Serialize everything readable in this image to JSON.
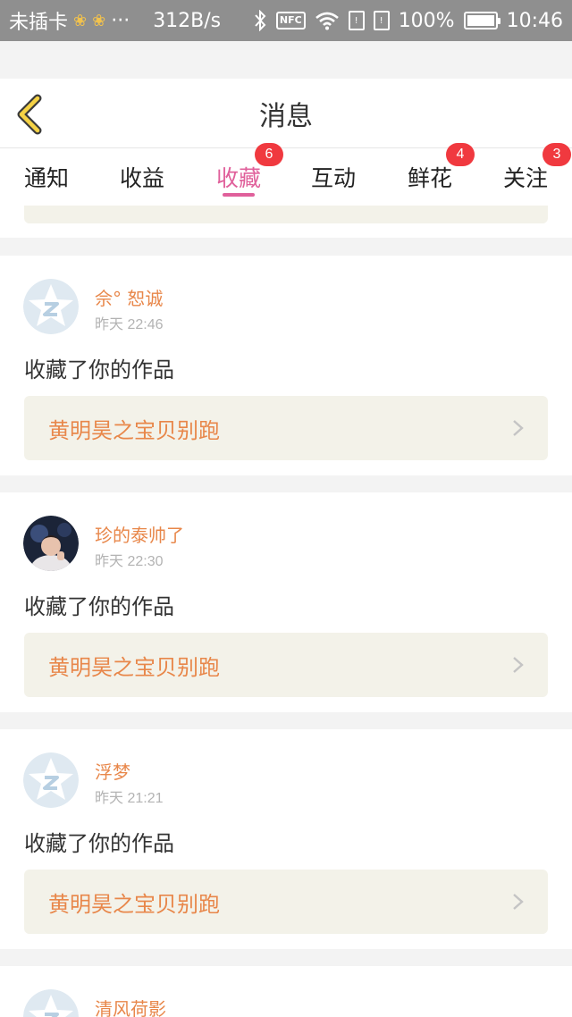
{
  "status_bar": {
    "carrier": "未插卡",
    "ellipsis": "···",
    "net_speed": "312B/s",
    "nfc": "NFC",
    "battery": "100%",
    "time": "10:46"
  },
  "header": {
    "title": "消息",
    "back_icon": "chevron-left-icon"
  },
  "tabs": [
    {
      "label": "通知",
      "badge": ""
    },
    {
      "label": "收益",
      "badge": ""
    },
    {
      "label": "收藏",
      "badge": "6",
      "active": true
    },
    {
      "label": "互动",
      "badge": ""
    },
    {
      "label": "鲜花",
      "badge": "4"
    },
    {
      "label": "关注",
      "badge": "3"
    }
  ],
  "colors": {
    "accent": "#e0609b",
    "username": "#e8874a",
    "badge": "#f0393f",
    "work_box": "#f3f2e9"
  },
  "messages": [
    {
      "username": "佘° 恕诚",
      "timestamp": "昨天 22:46",
      "action": "收藏了你的作品",
      "work_title": "黄明昊之宝贝别跑",
      "avatar": "default-star-avatar"
    },
    {
      "username": "珍的泰帅了",
      "timestamp": "昨天 22:30",
      "action": "收藏了你的作品",
      "work_title": "黄明昊之宝贝别跑",
      "avatar": "photo-avatar"
    },
    {
      "username": "浮梦",
      "timestamp": "昨天 21:21",
      "action": "收藏了你的作品",
      "work_title": "黄明昊之宝贝别跑",
      "avatar": "default-star-avatar"
    },
    {
      "username": "清风荷影",
      "timestamp": "",
      "action": "",
      "work_title": "",
      "avatar": "default-star-avatar"
    }
  ]
}
